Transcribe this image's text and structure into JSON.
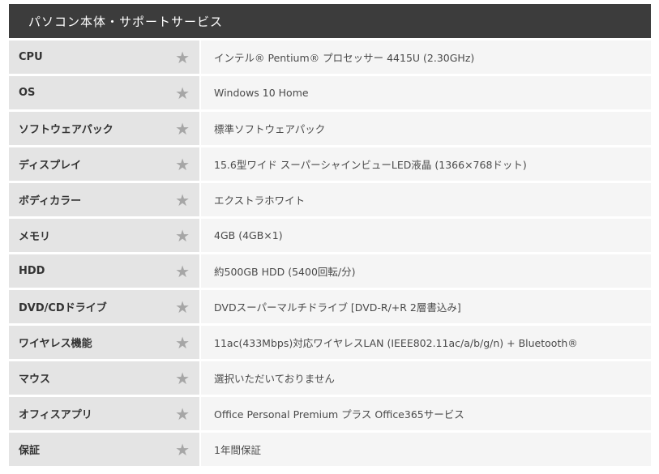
{
  "header": {
    "title": "パソコン本体・サポートサービス"
  },
  "star_glyph": "★",
  "specs": [
    {
      "label": "CPU",
      "value": "インテル® Pentium® プロセッサー 4415U (2.30GHz)"
    },
    {
      "label": "OS",
      "value": "Windows 10 Home"
    },
    {
      "label": "ソフトウェアパック",
      "value": "標準ソフトウェアパック"
    },
    {
      "label": "ディスプレイ",
      "value": "15.6型ワイド スーパーシャインビューLED液晶 (1366×768ドット)"
    },
    {
      "label": "ボディカラー",
      "value": "エクストラホワイト"
    },
    {
      "label": "メモリ",
      "value": "4GB (4GB×1)"
    },
    {
      "label": "HDD",
      "value": "約500GB HDD (5400回転/分)"
    },
    {
      "label": "DVD/CDドライブ",
      "value": "DVDスーパーマルチドライブ [DVD-R/+R 2層書込み]"
    },
    {
      "label": "ワイヤレス機能",
      "value": "11ac(433Mbps)対応ワイヤレスLAN (IEEE802.11ac/a/b/g/n) + Bluetooth®"
    },
    {
      "label": "マウス",
      "value": "選択いただいておりません"
    },
    {
      "label": "オフィスアプリ",
      "value": "Office Personal Premium プラス Office365サービス"
    },
    {
      "label": "保証",
      "value": "1年間保証"
    }
  ]
}
